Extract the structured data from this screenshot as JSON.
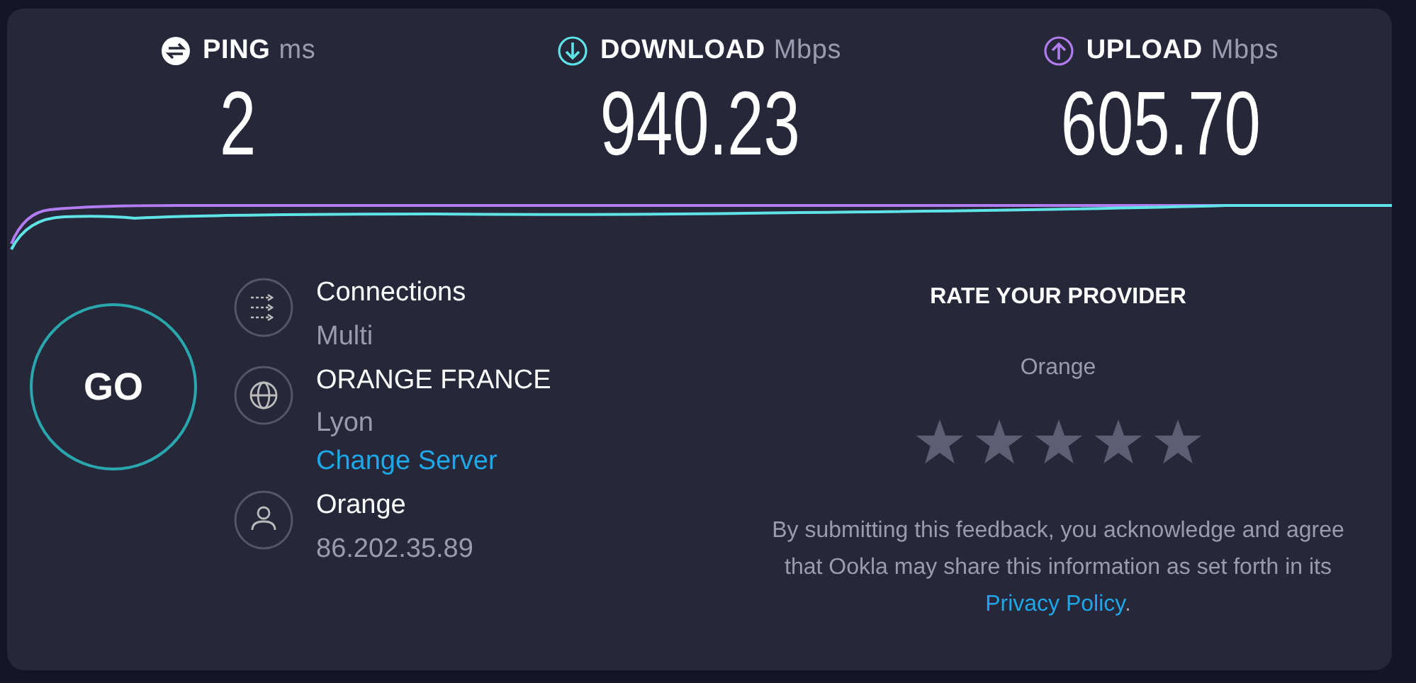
{
  "metrics": [
    {
      "kind": "ping",
      "label": "PING",
      "unit": "ms",
      "value": "2"
    },
    {
      "kind": "download",
      "label": "DOWNLOAD",
      "unit": "Mbps",
      "value": "940.23"
    },
    {
      "kind": "upload",
      "label": "UPLOAD",
      "unit": "Mbps",
      "value": "605.70"
    }
  ],
  "go_button": {
    "label": "GO"
  },
  "info": [
    {
      "kind": "connections",
      "title": "Connections",
      "lines": [
        {
          "text": "Multi",
          "link": false
        }
      ]
    },
    {
      "kind": "server",
      "title": "ORANGE FRANCE",
      "lines": [
        {
          "text": "Lyon",
          "link": false
        },
        {
          "text": "Change Server",
          "link": true
        }
      ]
    },
    {
      "kind": "provider",
      "title": "Orange",
      "lines": [
        {
          "text": "86.202.35.89",
          "link": false
        }
      ]
    }
  ],
  "rating": {
    "title": "RATE YOUR PROVIDER",
    "provider": "Orange",
    "stars": 0,
    "disclaimer": {
      "before": "By submitting this feedback, you acknowledge and agree that Ookla may share this information as set forth in its ",
      "link": "Privacy Policy",
      "after": "."
    }
  }
}
